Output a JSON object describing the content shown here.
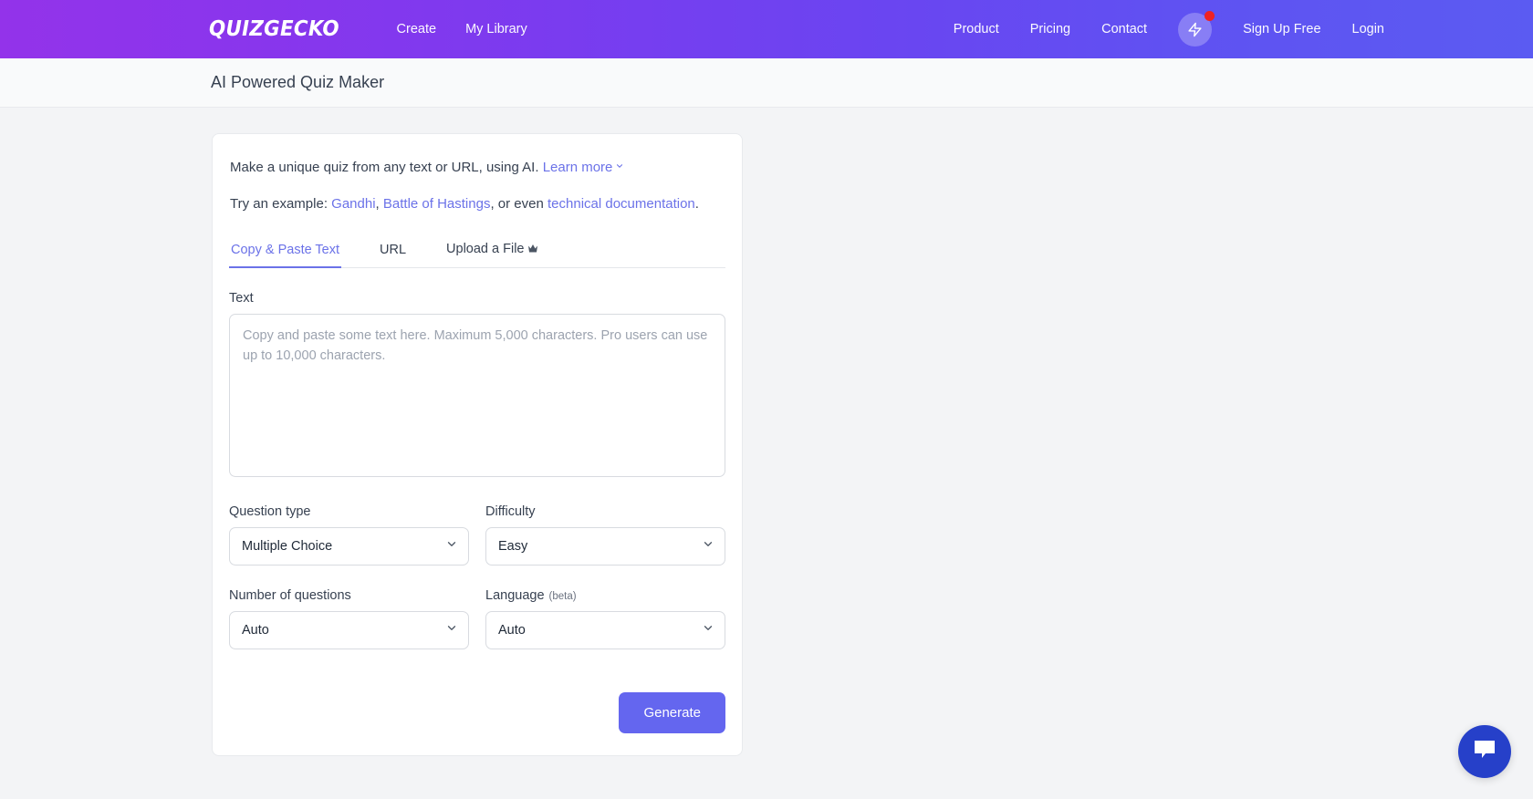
{
  "navbar": {
    "logo": "QUIZGECKO",
    "left_links": [
      {
        "label": "Create",
        "name": "nav-create"
      },
      {
        "label": "My Library",
        "name": "nav-my-library"
      }
    ],
    "right_links": [
      {
        "label": "Product",
        "name": "nav-product"
      },
      {
        "label": "Pricing",
        "name": "nav-pricing"
      },
      {
        "label": "Contact",
        "name": "nav-contact"
      }
    ],
    "bolt_icon": "lightning-bolt-icon",
    "bolt_badge": "notification-dot",
    "auth_links": [
      {
        "label": "Sign Up Free",
        "name": "nav-sign-up-free"
      },
      {
        "label": "Login",
        "name": "nav-login"
      }
    ],
    "gradient_start": "#9333ea",
    "gradient_end": "#5b5bf2",
    "badge_color": "#ef2222"
  },
  "header": {
    "title": "AI Powered Quiz Maker"
  },
  "card": {
    "intro": {
      "text_before": "Make a unique quiz from any text or URL, using AI.",
      "learn_more": "Learn more",
      "chevron_icon": "chevron-down-icon"
    },
    "example": {
      "prefix": "Try an example:",
      "link1": "Gandhi",
      "sep1": ",",
      "link2": "Battle of Hastings",
      "sep2": ", or even",
      "link3": "technical documentation",
      "suffix": "."
    },
    "tabs": [
      {
        "label": "Copy & Paste Text",
        "name": "tab-copy-paste-text",
        "active": true
      },
      {
        "label": "URL",
        "name": "tab-url",
        "active": false
      },
      {
        "label": "Upload a File",
        "name": "tab-upload-a-file",
        "active": false,
        "icon": "crown-icon"
      }
    ],
    "text_field": {
      "label": "Text",
      "value": "",
      "placeholder": "Copy and paste some text here. Maximum 5,000 characters. Pro users can use up to 10,000 characters."
    },
    "question_type": {
      "label": "Question type",
      "value": "Multiple Choice",
      "chevron_icon": "chevron-down-icon"
    },
    "difficulty": {
      "label": "Difficulty",
      "value": "Easy",
      "chevron_icon": "chevron-down-icon"
    },
    "number_of_questions": {
      "label": "Number of questions",
      "value": "Auto",
      "chevron_icon": "chevron-down-icon"
    },
    "language": {
      "label": "Language",
      "beta": "(beta)",
      "value": "Auto",
      "chevron_icon": "chevron-down-icon"
    },
    "generate_button": "Generate",
    "accent_color": "#6466ef",
    "link_color": "#6b72e8"
  },
  "chat": {
    "icon": "chat-bubble-icon",
    "color": "#2640c9"
  }
}
